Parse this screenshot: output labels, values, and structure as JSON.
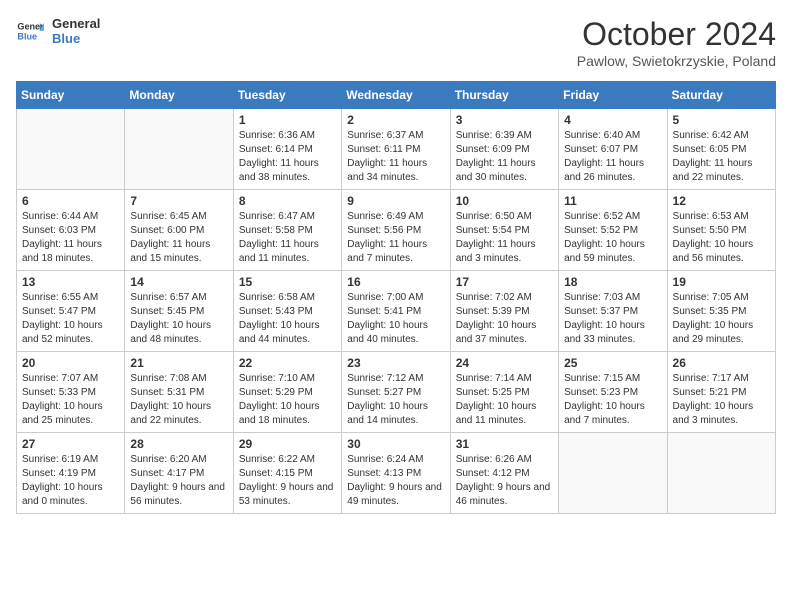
{
  "header": {
    "logo_line1": "General",
    "logo_line2": "Blue",
    "month_title": "October 2024",
    "location": "Pawlow, Swietokrzyskie, Poland"
  },
  "days_of_week": [
    "Sunday",
    "Monday",
    "Tuesday",
    "Wednesday",
    "Thursday",
    "Friday",
    "Saturday"
  ],
  "weeks": [
    [
      {
        "day": "",
        "sunrise": "",
        "sunset": "",
        "daylight": ""
      },
      {
        "day": "",
        "sunrise": "",
        "sunset": "",
        "daylight": ""
      },
      {
        "day": "1",
        "sunrise": "Sunrise: 6:36 AM",
        "sunset": "Sunset: 6:14 PM",
        "daylight": "Daylight: 11 hours and 38 minutes."
      },
      {
        "day": "2",
        "sunrise": "Sunrise: 6:37 AM",
        "sunset": "Sunset: 6:11 PM",
        "daylight": "Daylight: 11 hours and 34 minutes."
      },
      {
        "day": "3",
        "sunrise": "Sunrise: 6:39 AM",
        "sunset": "Sunset: 6:09 PM",
        "daylight": "Daylight: 11 hours and 30 minutes."
      },
      {
        "day": "4",
        "sunrise": "Sunrise: 6:40 AM",
        "sunset": "Sunset: 6:07 PM",
        "daylight": "Daylight: 11 hours and 26 minutes."
      },
      {
        "day": "5",
        "sunrise": "Sunrise: 6:42 AM",
        "sunset": "Sunset: 6:05 PM",
        "daylight": "Daylight: 11 hours and 22 minutes."
      }
    ],
    [
      {
        "day": "6",
        "sunrise": "Sunrise: 6:44 AM",
        "sunset": "Sunset: 6:03 PM",
        "daylight": "Daylight: 11 hours and 18 minutes."
      },
      {
        "day": "7",
        "sunrise": "Sunrise: 6:45 AM",
        "sunset": "Sunset: 6:00 PM",
        "daylight": "Daylight: 11 hours and 15 minutes."
      },
      {
        "day": "8",
        "sunrise": "Sunrise: 6:47 AM",
        "sunset": "Sunset: 5:58 PM",
        "daylight": "Daylight: 11 hours and 11 minutes."
      },
      {
        "day": "9",
        "sunrise": "Sunrise: 6:49 AM",
        "sunset": "Sunset: 5:56 PM",
        "daylight": "Daylight: 11 hours and 7 minutes."
      },
      {
        "day": "10",
        "sunrise": "Sunrise: 6:50 AM",
        "sunset": "Sunset: 5:54 PM",
        "daylight": "Daylight: 11 hours and 3 minutes."
      },
      {
        "day": "11",
        "sunrise": "Sunrise: 6:52 AM",
        "sunset": "Sunset: 5:52 PM",
        "daylight": "Daylight: 10 hours and 59 minutes."
      },
      {
        "day": "12",
        "sunrise": "Sunrise: 6:53 AM",
        "sunset": "Sunset: 5:50 PM",
        "daylight": "Daylight: 10 hours and 56 minutes."
      }
    ],
    [
      {
        "day": "13",
        "sunrise": "Sunrise: 6:55 AM",
        "sunset": "Sunset: 5:47 PM",
        "daylight": "Daylight: 10 hours and 52 minutes."
      },
      {
        "day": "14",
        "sunrise": "Sunrise: 6:57 AM",
        "sunset": "Sunset: 5:45 PM",
        "daylight": "Daylight: 10 hours and 48 minutes."
      },
      {
        "day": "15",
        "sunrise": "Sunrise: 6:58 AM",
        "sunset": "Sunset: 5:43 PM",
        "daylight": "Daylight: 10 hours and 44 minutes."
      },
      {
        "day": "16",
        "sunrise": "Sunrise: 7:00 AM",
        "sunset": "Sunset: 5:41 PM",
        "daylight": "Daylight: 10 hours and 40 minutes."
      },
      {
        "day": "17",
        "sunrise": "Sunrise: 7:02 AM",
        "sunset": "Sunset: 5:39 PM",
        "daylight": "Daylight: 10 hours and 37 minutes."
      },
      {
        "day": "18",
        "sunrise": "Sunrise: 7:03 AM",
        "sunset": "Sunset: 5:37 PM",
        "daylight": "Daylight: 10 hours and 33 minutes."
      },
      {
        "day": "19",
        "sunrise": "Sunrise: 7:05 AM",
        "sunset": "Sunset: 5:35 PM",
        "daylight": "Daylight: 10 hours and 29 minutes."
      }
    ],
    [
      {
        "day": "20",
        "sunrise": "Sunrise: 7:07 AM",
        "sunset": "Sunset: 5:33 PM",
        "daylight": "Daylight: 10 hours and 25 minutes."
      },
      {
        "day": "21",
        "sunrise": "Sunrise: 7:08 AM",
        "sunset": "Sunset: 5:31 PM",
        "daylight": "Daylight: 10 hours and 22 minutes."
      },
      {
        "day": "22",
        "sunrise": "Sunrise: 7:10 AM",
        "sunset": "Sunset: 5:29 PM",
        "daylight": "Daylight: 10 hours and 18 minutes."
      },
      {
        "day": "23",
        "sunrise": "Sunrise: 7:12 AM",
        "sunset": "Sunset: 5:27 PM",
        "daylight": "Daylight: 10 hours and 14 minutes."
      },
      {
        "day": "24",
        "sunrise": "Sunrise: 7:14 AM",
        "sunset": "Sunset: 5:25 PM",
        "daylight": "Daylight: 10 hours and 11 minutes."
      },
      {
        "day": "25",
        "sunrise": "Sunrise: 7:15 AM",
        "sunset": "Sunset: 5:23 PM",
        "daylight": "Daylight: 10 hours and 7 minutes."
      },
      {
        "day": "26",
        "sunrise": "Sunrise: 7:17 AM",
        "sunset": "Sunset: 5:21 PM",
        "daylight": "Daylight: 10 hours and 3 minutes."
      }
    ],
    [
      {
        "day": "27",
        "sunrise": "Sunrise: 6:19 AM",
        "sunset": "Sunset: 4:19 PM",
        "daylight": "Daylight: 10 hours and 0 minutes."
      },
      {
        "day": "28",
        "sunrise": "Sunrise: 6:20 AM",
        "sunset": "Sunset: 4:17 PM",
        "daylight": "Daylight: 9 hours and 56 minutes."
      },
      {
        "day": "29",
        "sunrise": "Sunrise: 6:22 AM",
        "sunset": "Sunset: 4:15 PM",
        "daylight": "Daylight: 9 hours and 53 minutes."
      },
      {
        "day": "30",
        "sunrise": "Sunrise: 6:24 AM",
        "sunset": "Sunset: 4:13 PM",
        "daylight": "Daylight: 9 hours and 49 minutes."
      },
      {
        "day": "31",
        "sunrise": "Sunrise: 6:26 AM",
        "sunset": "Sunset: 4:12 PM",
        "daylight": "Daylight: 9 hours and 46 minutes."
      },
      {
        "day": "",
        "sunrise": "",
        "sunset": "",
        "daylight": ""
      },
      {
        "day": "",
        "sunrise": "",
        "sunset": "",
        "daylight": ""
      }
    ]
  ]
}
